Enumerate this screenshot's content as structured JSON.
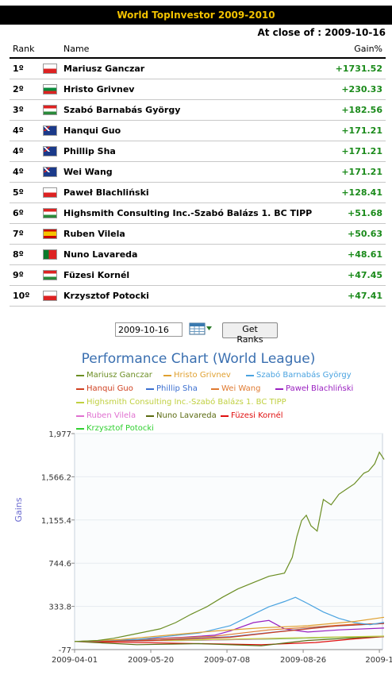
{
  "banner": {
    "title": "World TopInvestor 2009-2010"
  },
  "close_text": "At close of : 2009-10-16",
  "table": {
    "headers": {
      "rank": "Rank",
      "name": "Name",
      "gain": "Gain%"
    },
    "rows": [
      {
        "rank": "1º",
        "flag": "pl",
        "name": "Mariusz Ganczar",
        "gain": "+1731.52"
      },
      {
        "rank": "2º",
        "flag": "bg",
        "name": "Hristo Grivnev",
        "gain": "+230.33"
      },
      {
        "rank": "3º",
        "flag": "hu",
        "name": "Szabó Barnabás György",
        "gain": "+182.56"
      },
      {
        "rank": "4º",
        "flag": "au",
        "name": "Hanqui Guo",
        "gain": "+171.21"
      },
      {
        "rank": "4º",
        "flag": "au",
        "name": "Phillip Sha",
        "gain": "+171.21"
      },
      {
        "rank": "4º",
        "flag": "au",
        "name": "Wei Wang",
        "gain": "+171.21"
      },
      {
        "rank": "5º",
        "flag": "pl",
        "name": "Paweł Blachliński",
        "gain": "+128.41"
      },
      {
        "rank": "6º",
        "flag": "hu",
        "name": "Highsmith Consulting Inc.-Szabó Balázs 1. BC TIPP",
        "gain": "+51.68"
      },
      {
        "rank": "7º",
        "flag": "es",
        "name": "Ruben Vilela",
        "gain": "+50.63"
      },
      {
        "rank": "8º",
        "flag": "pt",
        "name": "Nuno Lavareda",
        "gain": "+48.61"
      },
      {
        "rank": "9º",
        "flag": "hu",
        "name": "Füzesi Kornél",
        "gain": "+47.45"
      },
      {
        "rank": "10º",
        "flag": "pl",
        "name": "Krzysztof Potocki",
        "gain": "+47.41"
      }
    ]
  },
  "controls": {
    "date_value": "2009-10-16",
    "calendar_icon": "calendar-icon",
    "get_ranks_label": "Get Ranks"
  },
  "chart_data": {
    "type": "line",
    "title": "Performance Chart (World League)",
    "ylabel": "Gains",
    "xlabel": "",
    "ylim": [
      -77,
      1977
    ],
    "y_ticks": [
      "1,977",
      "1,566.2",
      "1,155.4",
      "744.6",
      "333.8",
      "-77"
    ],
    "x_ticks": [
      "2009-04-01",
      "2009-05-20",
      "2009-07-08",
      "2009-08-26",
      "2009-1"
    ],
    "x_tick_days": [
      0,
      49,
      98,
      147,
      196
    ],
    "x_range_days": [
      0,
      198
    ],
    "legend_position": "top",
    "series": [
      {
        "name": "Mariusz Ganczar",
        "color": "#6b8e23",
        "points": [
          [
            0,
            0
          ],
          [
            15,
            10
          ],
          [
            25,
            30
          ],
          [
            35,
            60
          ],
          [
            45,
            90
          ],
          [
            55,
            120
          ],
          [
            65,
            180
          ],
          [
            75,
            260
          ],
          [
            85,
            330
          ],
          [
            95,
            420
          ],
          [
            105,
            500
          ],
          [
            115,
            560
          ],
          [
            125,
            620
          ],
          [
            135,
            650
          ],
          [
            140,
            800
          ],
          [
            143,
            1000
          ],
          [
            146,
            1150
          ],
          [
            149,
            1200
          ],
          [
            152,
            1100
          ],
          [
            156,
            1050
          ],
          [
            160,
            1350
          ],
          [
            165,
            1300
          ],
          [
            170,
            1400
          ],
          [
            175,
            1450
          ],
          [
            180,
            1500
          ],
          [
            183,
            1550
          ],
          [
            186,
            1600
          ],
          [
            189,
            1620
          ],
          [
            193,
            1690
          ],
          [
            196,
            1800
          ],
          [
            199,
            1731
          ]
        ]
      },
      {
        "name": "Hristo Grivnev",
        "color": "#e0a030",
        "points": [
          [
            0,
            0
          ],
          [
            30,
            20
          ],
          [
            60,
            60
          ],
          [
            90,
            100
          ],
          [
            120,
            130
          ],
          [
            150,
            150
          ],
          [
            180,
            190
          ],
          [
            199,
            230
          ]
        ]
      },
      {
        "name": "Szabó Barnabás György",
        "color": "#4aa3e0",
        "points": [
          [
            0,
            0
          ],
          [
            40,
            20
          ],
          [
            80,
            80
          ],
          [
            100,
            150
          ],
          [
            115,
            260
          ],
          [
            125,
            330
          ],
          [
            135,
            380
          ],
          [
            142,
            420
          ],
          [
            150,
            360
          ],
          [
            160,
            280
          ],
          [
            170,
            220
          ],
          [
            180,
            180
          ],
          [
            190,
            160
          ],
          [
            199,
            182
          ]
        ]
      },
      {
        "name": "Hanqui Guo",
        "color": "#d04020",
        "points": [
          [
            0,
            0
          ],
          [
            50,
            10
          ],
          [
            100,
            40
          ],
          [
            130,
            90
          ],
          [
            150,
            120
          ],
          [
            170,
            150
          ],
          [
            199,
            171
          ]
        ]
      },
      {
        "name": "Phillip Sha",
        "color": "#3b6fd0",
        "points": [
          [
            0,
            0
          ],
          [
            55,
            15
          ],
          [
            100,
            45
          ],
          [
            135,
            100
          ],
          [
            160,
            140
          ],
          [
            185,
            160
          ],
          [
            199,
            171
          ]
        ]
      },
      {
        "name": "Wei Wang",
        "color": "#e07a30",
        "points": [
          [
            0,
            0
          ],
          [
            45,
            20
          ],
          [
            90,
            50
          ],
          [
            125,
            110
          ],
          [
            155,
            140
          ],
          [
            180,
            165
          ],
          [
            199,
            171
          ]
        ]
      },
      {
        "name": "Paweł Blachliński",
        "color": "#9a20c0",
        "points": [
          [
            0,
            0
          ],
          [
            40,
            20
          ],
          [
            70,
            40
          ],
          [
            90,
            60
          ],
          [
            100,
            100
          ],
          [
            115,
            180
          ],
          [
            125,
            200
          ],
          [
            135,
            120
          ],
          [
            150,
            90
          ],
          [
            170,
            110
          ],
          [
            199,
            128
          ]
        ]
      },
      {
        "name": "Highsmith Consulting Inc.-Szabó Balázs 1. BC TIPP",
        "color": "#c0d040",
        "points": [
          [
            0,
            0
          ],
          [
            60,
            10
          ],
          [
            110,
            25
          ],
          [
            160,
            40
          ],
          [
            199,
            51
          ]
        ]
      },
      {
        "name": "Ruben Vilela",
        "color": "#e070d0",
        "points": [
          [
            0,
            0
          ],
          [
            50,
            5
          ],
          [
            110,
            20
          ],
          [
            160,
            40
          ],
          [
            199,
            50
          ]
        ]
      },
      {
        "name": "Nuno Lavareda",
        "color": "#5a6a10",
        "points": [
          [
            0,
            0
          ],
          [
            40,
            -30
          ],
          [
            80,
            -20
          ],
          [
            120,
            -40
          ],
          [
            150,
            10
          ],
          [
            175,
            30
          ],
          [
            199,
            48
          ]
        ]
      },
      {
        "name": "Füzesi Kornél",
        "color": "#e01010",
        "points": [
          [
            0,
            0
          ],
          [
            60,
            -15
          ],
          [
            120,
            -30
          ],
          [
            155,
            -10
          ],
          [
            180,
            25
          ],
          [
            199,
            47
          ]
        ]
      },
      {
        "name": "Krzysztof Potocki",
        "color": "#30d030",
        "points": [
          [
            0,
            0
          ],
          [
            70,
            10
          ],
          [
            130,
            25
          ],
          [
            170,
            40
          ],
          [
            199,
            47
          ]
        ]
      }
    ]
  }
}
